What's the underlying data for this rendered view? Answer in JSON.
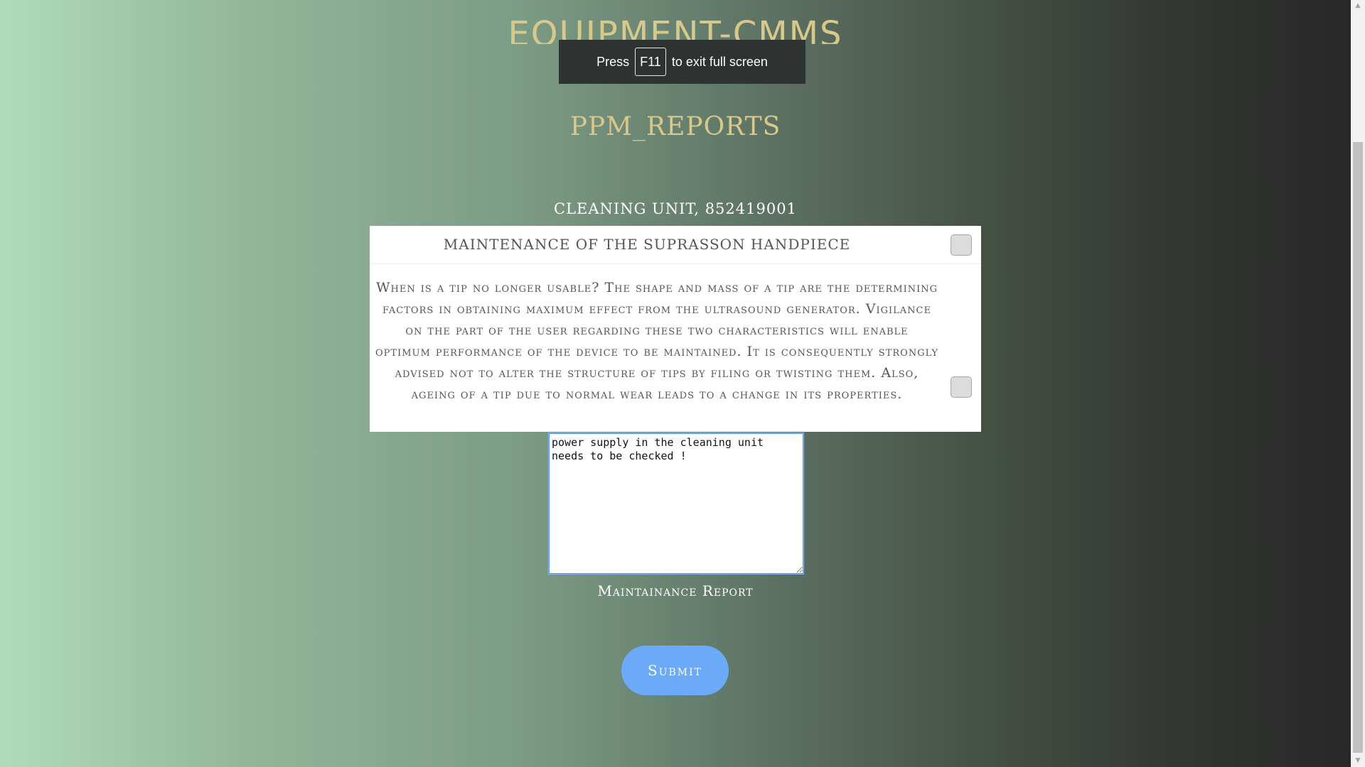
{
  "header": {
    "brand": "EQUIPMENT-CMMS",
    "page_title": "PPM_REPORTS"
  },
  "fullscreen_toast": {
    "prefix": "Press",
    "key": "F11",
    "suffix": "to exit full screen"
  },
  "equipment": {
    "title": "CLEANING UNIT, 852419001"
  },
  "checklist": {
    "items": [
      {
        "text": "MAINTENANCE OF THE SUPRASSON HANDPIECE",
        "checked": false
      },
      {
        "text": "When is a tip no longer usable? The shape and mass of a tip are the determining factors in obtaining maximum effect from the ultrasound generator. Vigilance on the part of the user regarding these two characteristics will enable optimum performance of the device to be maintained. It is consequently strongly advised not to alter the structure of tips by filing or twisting them. Also, ageing of a tip due to normal wear leads to a change in its properties.",
        "checked": false
      }
    ]
  },
  "report": {
    "value": "power supply in the cleaning unit needs to be checked !",
    "label": "Maintainance Report"
  },
  "actions": {
    "submit_label": "Submit"
  },
  "colors": {
    "accent_gold": "#d8c98a",
    "submit_blue": "#6aaaf7"
  }
}
